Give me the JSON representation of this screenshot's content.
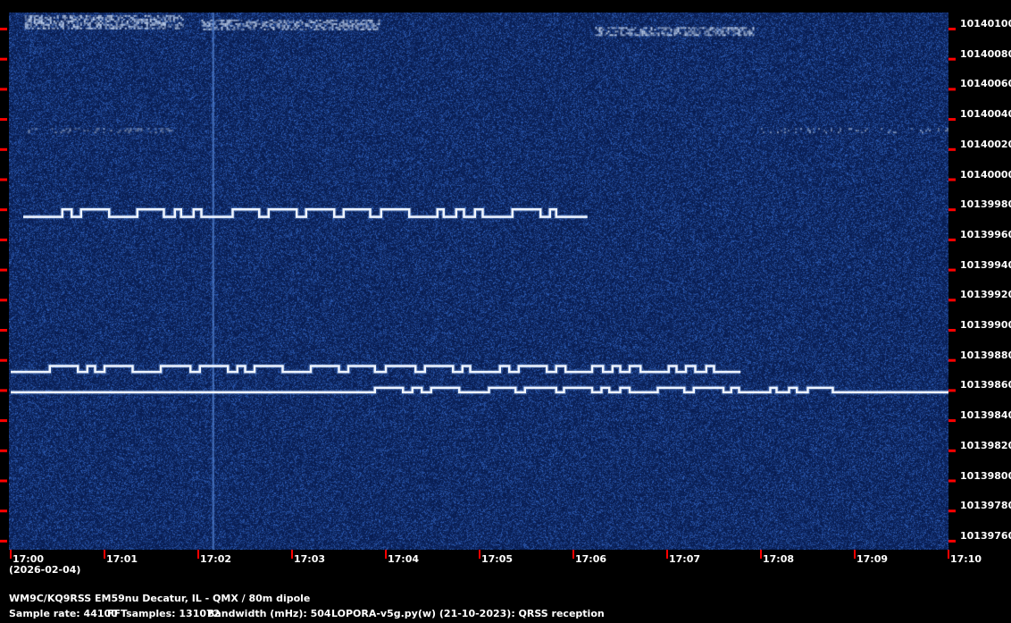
{
  "chart_data": {
    "type": "heatmap",
    "subtype": "spectrogram",
    "x_ticks": [
      "17:00",
      "17:01",
      "17:02",
      "17:03",
      "17:04",
      "17:05",
      "17:06",
      "17:07",
      "17:08",
      "17:09",
      "17:10"
    ],
    "date_label": "(2026-02-04)",
    "xlim": [
      "17:00:00",
      "17:10:00"
    ],
    "y_ticks": [
      10140100,
      10140080,
      10140060,
      10140040,
      10140020,
      10140000,
      10139980,
      10139960,
      10139940,
      10139920,
      10139900,
      10139880,
      10139860,
      10139840,
      10139820,
      10139800,
      10139780,
      10139760
    ],
    "ylim": [
      10139754,
      10140111
    ],
    "colors": {
      "background": "#0b2257",
      "trace": "#eef4ff",
      "tick": "#ff0000",
      "noise": "#1e4a99"
    },
    "traces": [
      {
        "start": "17:00:08",
        "end": "17:06:09",
        "low": 10139975,
        "high": 10139980,
        "high_segments": [
          [
            "17:00:33",
            "17:00:39"
          ],
          [
            "17:00:45",
            "17:01:03"
          ],
          [
            "17:01:21",
            "17:01:38"
          ],
          [
            "17:01:45",
            "17:01:49"
          ],
          [
            "17:01:57",
            "17:02:02"
          ],
          [
            "17:02:22",
            "17:02:39"
          ],
          [
            "17:02:45",
            "17:03:03"
          ],
          [
            "17:03:09",
            "17:03:27"
          ],
          [
            "17:03:33",
            "17:03:50"
          ],
          [
            "17:03:57",
            "17:04:15"
          ],
          [
            "17:04:33",
            "17:04:37"
          ],
          [
            "17:04:45",
            "17:04:50"
          ],
          [
            "17:04:57",
            "17:05:02"
          ],
          [
            "17:05:21",
            "17:05:39"
          ],
          [
            "17:05:45",
            "17:05:49"
          ]
        ]
      },
      {
        "start": "17:00:00",
        "end": "17:07:47",
        "low": 10139872,
        "high": 10139876,
        "high_segments": [
          [
            "17:00:25",
            "17:00:43"
          ],
          [
            "17:00:49",
            "17:00:54"
          ],
          [
            "17:01:00",
            "17:01:18"
          ],
          [
            "17:01:36",
            "17:01:55"
          ],
          [
            "17:02:01",
            "17:02:19"
          ],
          [
            "17:02:25",
            "17:02:30"
          ],
          [
            "17:02:36",
            "17:02:54"
          ],
          [
            "17:03:12",
            "17:03:30"
          ],
          [
            "17:03:36",
            "17:03:53"
          ],
          [
            "17:04:00",
            "17:04:19"
          ],
          [
            "17:04:25",
            "17:04:43"
          ],
          [
            "17:04:49",
            "17:04:54"
          ],
          [
            "17:05:13",
            "17:05:19"
          ],
          [
            "17:05:25",
            "17:05:43"
          ],
          [
            "17:05:49",
            "17:05:55"
          ],
          [
            "17:06:12",
            "17:06:19"
          ],
          [
            "17:06:25",
            "17:06:30"
          ],
          [
            "17:06:36",
            "17:06:43"
          ],
          [
            "17:07:01",
            "17:07:06"
          ],
          [
            "17:07:12",
            "17:07:18"
          ],
          [
            "17:07:25",
            "17:07:30"
          ]
        ]
      },
      {
        "start": "17:00:00",
        "end": "17:10:00",
        "low": 10139858.5,
        "high": 10139861.5,
        "high_segments": [
          [
            "17:03:53",
            "17:04:11"
          ],
          [
            "17:04:17",
            "17:04:23"
          ],
          [
            "17:04:29",
            "17:04:47"
          ],
          [
            "17:05:06",
            "17:05:23"
          ],
          [
            "17:05:29",
            "17:05:49"
          ],
          [
            "17:05:54",
            "17:06:12"
          ],
          [
            "17:06:18",
            "17:06:23"
          ],
          [
            "17:06:30",
            "17:06:36"
          ],
          [
            "17:06:54",
            "17:07:11"
          ],
          [
            "17:07:17",
            "17:07:36"
          ],
          [
            "17:07:41",
            "17:07:46"
          ],
          [
            "17:08:06",
            "17:08:10"
          ],
          [
            "17:08:18",
            "17:08:23"
          ],
          [
            "17:08:30",
            "17:08:46"
          ]
        ]
      }
    ],
    "noise_bands": [
      {
        "start": "17:00:09",
        "end": "17:01:50",
        "f_low": 10140100,
        "f_high": 10140109,
        "strength": 0.9
      },
      {
        "start": "17:02:02",
        "end": "17:03:56",
        "f_low": 10140100,
        "f_high": 10140106,
        "strength": 0.8
      },
      {
        "start": "17:06:14",
        "end": "17:07:55",
        "f_low": 10140096,
        "f_high": 10140101,
        "strength": 0.9
      },
      {
        "start": "17:00:10",
        "end": "17:01:43",
        "f_low": 10140031,
        "f_high": 10140034,
        "strength": 0.35
      },
      {
        "start": "17:08:00",
        "end": "17:10:00",
        "f_low": 10140031,
        "f_high": 10140034,
        "strength": 0.35
      }
    ],
    "vertical_lines": [
      "17:02:09"
    ]
  },
  "footer": {
    "station": "WM9C/KQ9RSS EM59nu Decatur, IL - QMX / 80m dipole",
    "sample_rate": "Sample rate: 44100",
    "fft_samples": "FFTsamples: 131072",
    "bandwidth": "Bandwidth (mHz): 504",
    "software": "LOPORA-v5g.py(w) (21-10-2023): QRSS reception"
  }
}
